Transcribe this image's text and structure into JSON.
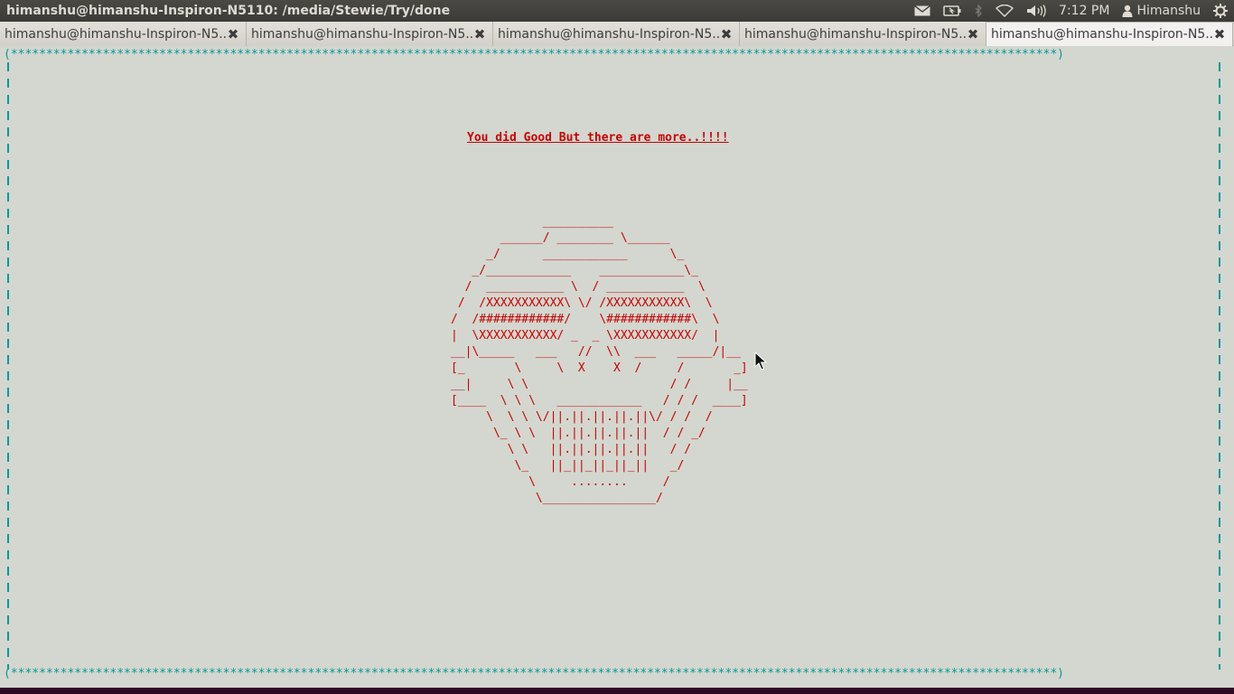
{
  "window": {
    "title": "himanshu@himanshu-Inspiron-N5110: /media/Stewie/Try/done"
  },
  "panel": {
    "clock": "7:12 PM",
    "user": "Himanshu",
    "icons": [
      "mail-icon",
      "battery-icon",
      "bluetooth-icon",
      "wifi-icon",
      "volume-icon",
      "user-icon",
      "power-gear-icon"
    ]
  },
  "tabs": [
    {
      "label": "himanshu@himanshu-Inspiron-N5...",
      "close": "✖"
    },
    {
      "label": "himanshu@himanshu-Inspiron-N5...",
      "close": "✖"
    },
    {
      "label": "himanshu@himanshu-Inspiron-N5...",
      "close": "✖"
    },
    {
      "label": "himanshu@himanshu-Inspiron-N5...",
      "close": "✖"
    },
    {
      "label": "himanshu@himanshu-Inspiron-N5...",
      "close": "✖"
    }
  ],
  "terminal": {
    "border_top": "(****************************************************************************************************************************************************)",
    "border_bottom": "(****************************************************************************************************************************************************)",
    "message": "You did Good But there are more..!!!!",
    "art": "             __________\n       ______/ ________ \\______\n     _/      ____________      \\_\n   _/____________    ____________\\_\n  /  ___________ \\  / ___________  \\\n /  /XXXXXXXXXXX\\ \\/ /XXXXXXXXXXX\\  \\\n/  /############/    \\############\\  \\\n|  \\XXXXXXXXXXX/ _  _ \\XXXXXXXXXXX/  |\n__|\\_____   ___   //  \\\\  ___   _____/|__\n[_       \\     \\  X    X  /     /       _]\n__|     \\ \\                    / /     |__\n[____  \\ \\ \\   ____________   / / /  ____]\n     \\  \\ \\ \\/||.||.||.||.||\\/ / /  /\n      \\_ \\ \\  ||.||.||.||.||  / / _/\n        \\ \\   ||.||.||.||.||   / /\n         \\_   ||_||_||_||_||   _/\n           \\     ........     /\n            \\________________/"
  },
  "colors": {
    "terminal_bg": "#d3d7cf",
    "text_red": "#cc0000",
    "border_teal": "#06989a",
    "panel_bg": "#3c3b37"
  }
}
